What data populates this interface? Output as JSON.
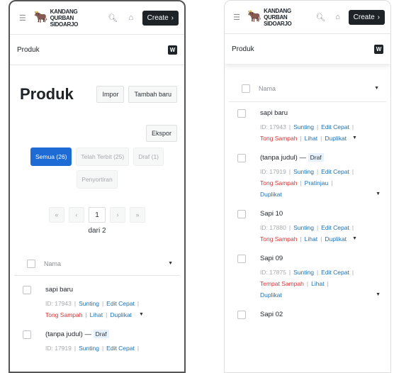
{
  "topbar": {
    "logo_line1": "KANDANG QURBAN",
    "logo_line2": "SIDOARJO",
    "create_label": "Create",
    "icons": [
      "menu-icon",
      "search-icon",
      "home-icon",
      "chevron-right-icon"
    ]
  },
  "breadcrumb": "Produk",
  "page": {
    "title": "Produk",
    "import_label": "Impor",
    "add_new_label": "Tambah baru",
    "export_label": "Ekspor",
    "filters": [
      {
        "label": "Semua (26)",
        "active": true
      },
      {
        "label": "Telah Terbit (25)",
        "active": false
      },
      {
        "label": "Draf (1)",
        "active": false
      },
      {
        "label": "Penyortiran",
        "active": false
      }
    ],
    "pagination": {
      "first": "«",
      "prev": "‹",
      "current": "1",
      "next": "›",
      "last": "»",
      "of_label": "dari 2"
    }
  },
  "table": {
    "name_header": "Nama"
  },
  "left_rows": [
    {
      "title": "sapi baru",
      "id": "ID: 17943",
      "actions1": [
        "Sunting",
        "Edit Cepat"
      ],
      "trash": "Tong Sampah",
      "actions2": [
        "Lihat",
        "Duplikat"
      ]
    },
    {
      "title": "(tanpa judul) —",
      "draft": "Draf",
      "id": "ID: 17919",
      "actions1": [
        "Sunting",
        "Edit Cepat"
      ]
    }
  ],
  "right_rows": [
    {
      "title": "sapi baru",
      "id": "ID: 17943",
      "edit": "Sunting",
      "quick": "Edit Cepat",
      "trash": "Tong Sampah",
      "view": "Lihat",
      "dup": "Duplikat"
    },
    {
      "title": "(tanpa judul) —",
      "draft": "Draf",
      "id": "ID: 17919",
      "edit": "Sunting",
      "quick": "Edit Cepat",
      "trash": "Tong Sampah",
      "view": "Pratinjau",
      "dup": "Duplikat"
    },
    {
      "title": "Sapi 10",
      "id": "ID: 17880",
      "edit": "Sunting",
      "quick": "Edit Cepat",
      "trash": "Tong Sampah",
      "view": "Lihat",
      "dup": "Duplikat"
    },
    {
      "title": "Sapi 09",
      "id": "ID: 17875",
      "edit": "Sunting",
      "quick": "Edit Cepat",
      "trash": "Tempat Sampah",
      "view": "Lihat",
      "dup": "Duplikat"
    },
    {
      "title": "Sapi 02"
    }
  ],
  "colors": {
    "primary": "#1e6bd6",
    "link": "#2271b1",
    "trash": "#d63638",
    "dark": "#1d2327"
  }
}
